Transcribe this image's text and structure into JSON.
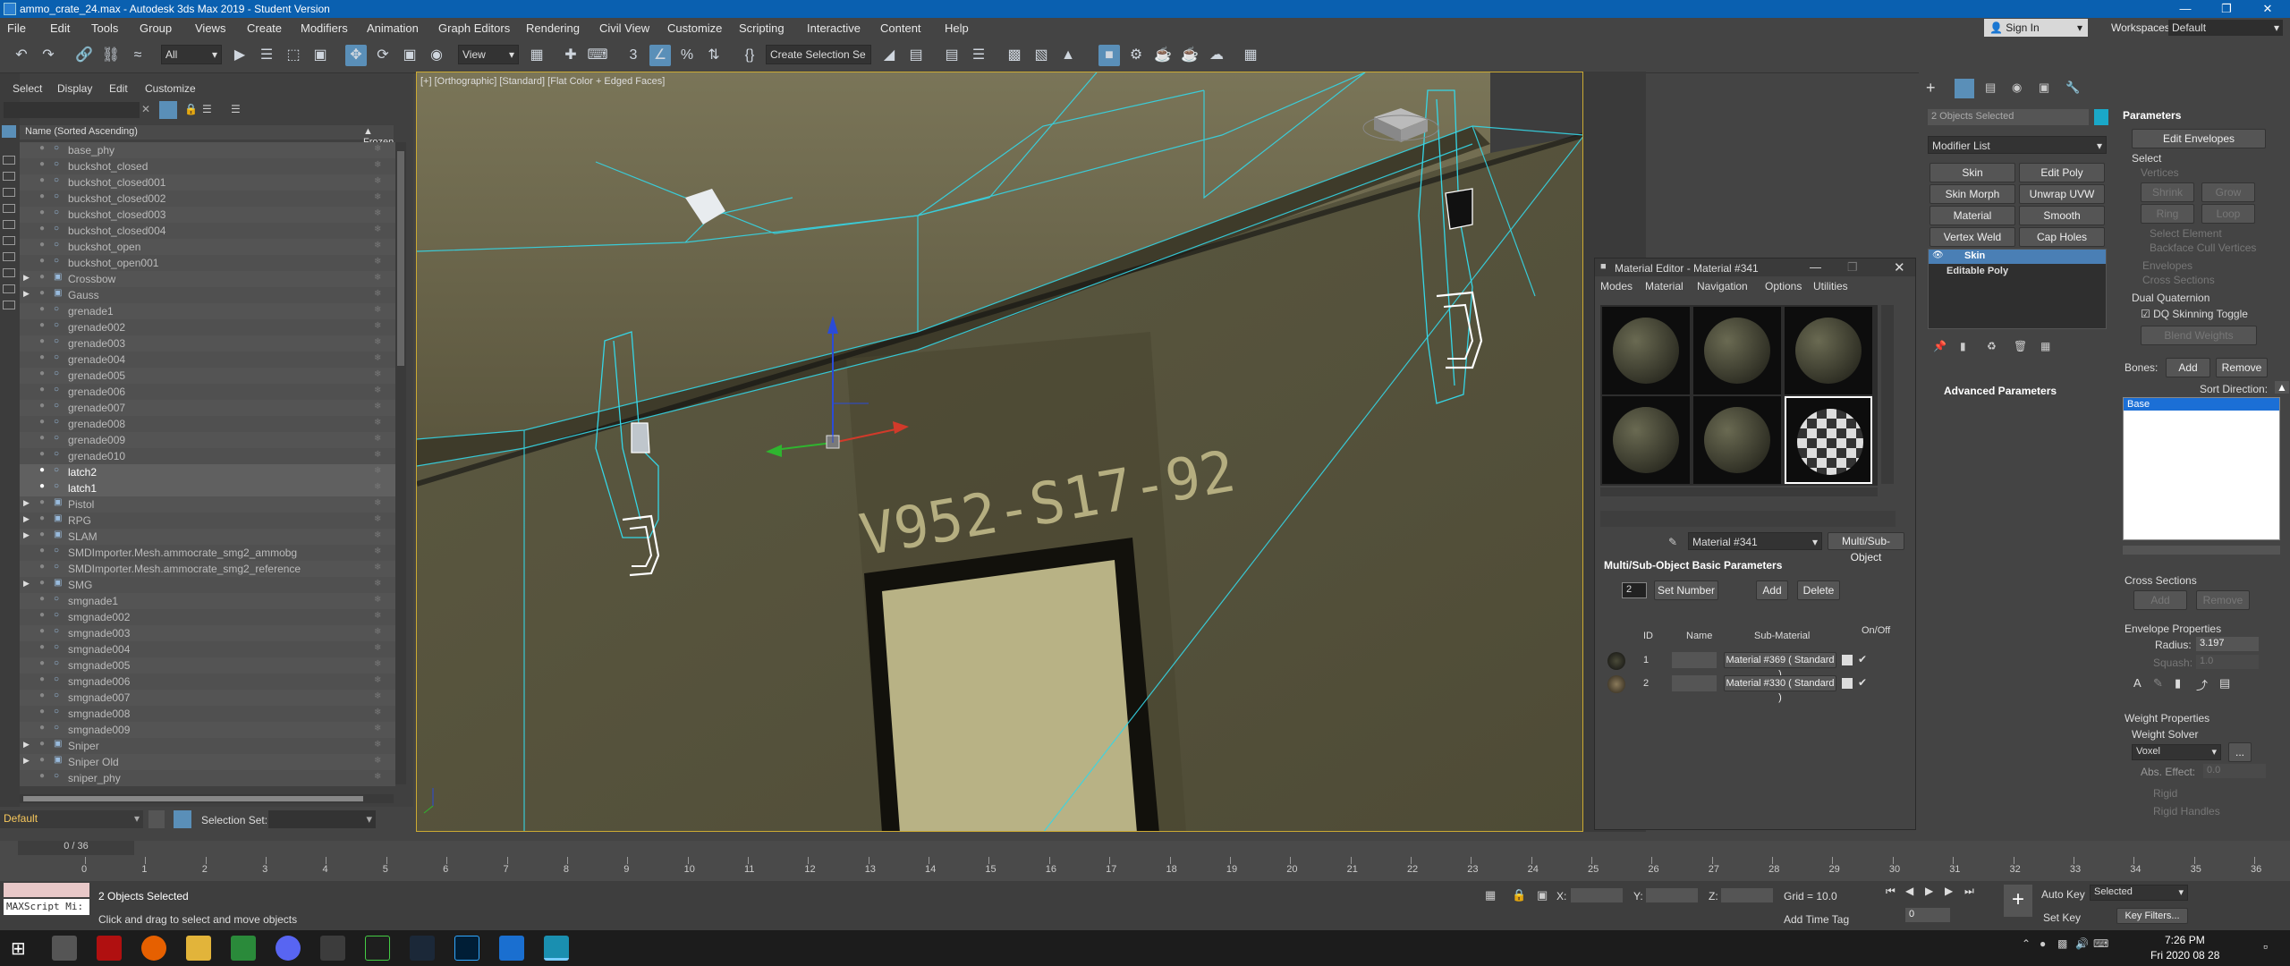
{
  "title": "ammo_crate_24.max - Autodesk 3ds Max 2019 - Student Version",
  "menu": [
    "File",
    "Edit",
    "Tools",
    "Group",
    "Views",
    "Create",
    "Modifiers",
    "Animation",
    "Graph Editors",
    "Rendering",
    "Civil View",
    "Customize",
    "Scripting",
    "Interactive",
    "Content",
    "Help"
  ],
  "signin": "Sign In",
  "workspaces_label": "Workspaces:",
  "workspaces_value": "Default",
  "toolbar": {
    "filter": "All",
    "refcoord": "View",
    "selset": "Create Selection Se"
  },
  "explorer": {
    "tabs": [
      "Select",
      "Display",
      "Edit",
      "Customize"
    ],
    "col_name": "Name (Sorted Ascending)",
    "col_frozen": "▲ Frozen",
    "items": [
      "base_phy",
      "buckshot_closed",
      "buckshot_closed001",
      "buckshot_closed002",
      "buckshot_closed003",
      "buckshot_closed004",
      "buckshot_open",
      "buckshot_open001",
      "Crossbow",
      "Gauss",
      "grenade1",
      "grenade002",
      "grenade003",
      "grenade004",
      "grenade005",
      "grenade006",
      "grenade007",
      "grenade008",
      "grenade009",
      "grenade010",
      "latch2",
      "latch1",
      "Pistol",
      "RPG",
      "SLAM",
      "SMDImporter.Mesh.ammocrate_smg2_ammobg",
      "SMDImporter.Mesh.ammocrate_smg2_reference",
      "SMG",
      "smgnade1",
      "smgnade002",
      "smgnade003",
      "smgnade004",
      "smgnade005",
      "smgnade006",
      "smgnade007",
      "smgnade008",
      "smgnade009",
      "Sniper",
      "Sniper Old",
      "sniper_phy"
    ],
    "layer": "Default",
    "selset_label": "Selection Set:"
  },
  "viewport": {
    "label": "[+] [Orthographic] [Standard] [Flat Color + Edged Faces]",
    "stencil": "V952-S17-92"
  },
  "cmd": {
    "objects_selected": "2 Objects Selected",
    "modifier_list": "Modifier List",
    "mod_buttons": [
      "Skin",
      "Edit Poly",
      "Skin Morph",
      "Unwrap UVW",
      "Material",
      "Smooth",
      "Vertex Weld",
      "Cap Holes"
    ],
    "stack": [
      "Skin",
      "Editable Poly"
    ],
    "adv_params": "Advanced Parameters",
    "parameters": "Parameters",
    "edit_envelopes": "Edit Envelopes",
    "select": "Select",
    "vertices": "Vertices",
    "shrink": "Shrink",
    "grow": "Grow",
    "ring": "Ring",
    "loop": "Loop",
    "select_element": "Select Element",
    "backface": "Backface Cull Vertices",
    "envelopes": "Envelopes",
    "cross_sections": "Cross Sections",
    "dual_quat": "Dual Quaternion",
    "dq_toggle": "DQ Skinning Toggle",
    "blend_weights": "Blend Weights",
    "bones": "Bones:",
    "add": "Add",
    "remove": "Remove",
    "sort_dir": "Sort Direction:",
    "bone_item": "Base",
    "cross_sections2": "Cross Sections",
    "env_props": "Envelope Properties",
    "radius_lbl": "Radius:",
    "radius_val": "3.197",
    "squash_lbl": "Squash:",
    "squash_val": "1.0",
    "weight_props": "Weight Properties",
    "weight_solver": "Weight Solver",
    "voxel": "Voxel",
    "abs_effect": "Abs. Effect:",
    "abs_val": "0.0",
    "rigid": "Rigid",
    "rigid_handles": "Rigid Handles"
  },
  "mated": {
    "title": "Material Editor - Material #341",
    "menus": [
      "Modes",
      "Material",
      "Navigation",
      "Options",
      "Utilities"
    ],
    "mat_name": "Material #341",
    "mat_type": "Multi/Sub-Object",
    "rollout": "Multi/Sub-Object Basic Parameters",
    "count": "2",
    "set_number": "Set Number",
    "add": "Add",
    "delete": "Delete",
    "col_id": "ID",
    "col_name": "Name",
    "col_sub": "Sub-Material",
    "col_onoff": "On/Off",
    "rows": [
      {
        "id": "1",
        "sub": "Material #369  ( Standard )"
      },
      {
        "id": "2",
        "sub": "Material #330  ( Standard )"
      }
    ]
  },
  "timeline": {
    "frame": "0 / 36",
    "ticks": [
      "0",
      "1",
      "2",
      "3",
      "4",
      "5",
      "6",
      "7",
      "8",
      "9",
      "10",
      "11",
      "12",
      "13",
      "14",
      "15",
      "16",
      "17",
      "18",
      "19",
      "20",
      "21",
      "22",
      "23",
      "24",
      "25",
      "26",
      "27",
      "28",
      "29",
      "30",
      "31",
      "32",
      "33",
      "34",
      "35",
      "36"
    ]
  },
  "status": {
    "maxscript": "MAXScript Mi:",
    "selected": "2 Objects Selected",
    "prompt": "Click and drag to select and move objects",
    "x": "X:",
    "y": "Y:",
    "z": "Z:",
    "grid": "Grid = 10.0",
    "addtime": "Add Time Tag",
    "autokey": "Auto Key",
    "setkey": "Set Key",
    "selected_dd": "Selected",
    "keyfilters": "Key Filters...",
    "frame_val": "0"
  },
  "clock": {
    "time": "7:26 PM",
    "date": "Fri 2020 08 28"
  },
  "colors": {
    "accent": "#0a60b0",
    "selection": "#1b6fd6",
    "wire": "#35d6e6"
  }
}
